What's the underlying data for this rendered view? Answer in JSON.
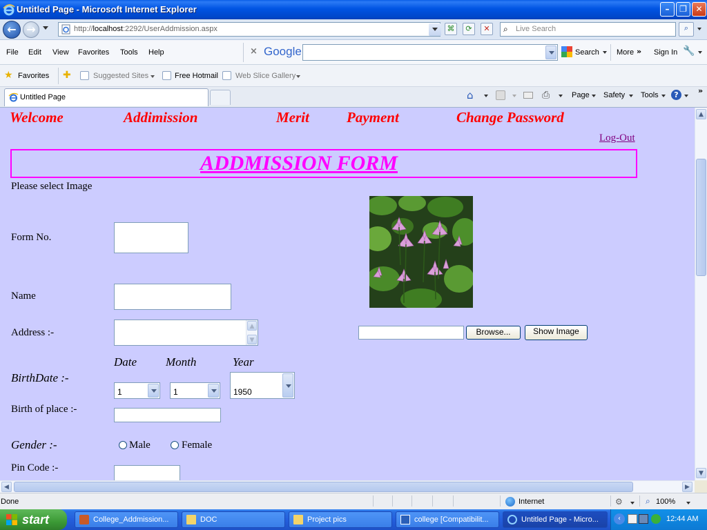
{
  "window": {
    "title": "Untitled Page - Microsoft Internet Explorer"
  },
  "addressbar": {
    "url_prefix": "http://",
    "url_host": "localhost",
    "url_rest": ":2292/UserAddmission.aspx",
    "live_search_placeholder": "Live Search"
  },
  "menubar": {
    "items": [
      "File",
      "Edit",
      "View",
      "Favorites",
      "Tools",
      "Help"
    ],
    "google_logo": "Google",
    "search_label": "Search",
    "more_label": "More",
    "signin_label": "Sign In"
  },
  "favoritesbar": {
    "favorites_label": "Favorites",
    "items": [
      "Suggested Sites",
      "Free Hotmail",
      "Web Slice Gallery"
    ]
  },
  "tabbar": {
    "tab_title": "Untitled Page",
    "page_label": "Page",
    "safety_label": "Safety",
    "tools_label": "Tools"
  },
  "page": {
    "nav": [
      "Welcome",
      "Addimission",
      "Merit",
      "Payment",
      "Change Password"
    ],
    "logout": "Log-Out",
    "form_title": "ADDMISSION FORM",
    "select_image_label": "Please select Image",
    "labels": {
      "form_no": "Form No.",
      "name": "Name",
      "address": "Address :-",
      "birthdate": "BirthDate :-",
      "date": "Date",
      "month": "Month",
      "year": "Year",
      "birth_place": "Birth of place :-",
      "gender": "Gender :-",
      "male": "Male",
      "female": "Female",
      "pin_code": "Pin Code :-"
    },
    "selects": {
      "date": "1",
      "month": "1",
      "year": "1950"
    },
    "browse_label": "Browse...",
    "show_image_label": "Show Image"
  },
  "statusbar": {
    "status": "Done",
    "zone": "Internet",
    "zoom": "100%"
  },
  "taskbar": {
    "start_label": "start",
    "tasks": [
      "College_Addmission...",
      "DOC",
      "Project pics",
      "college [Compatibilit...",
      "Untitled Page - Micro..."
    ],
    "clock": "12:44 AM"
  },
  "colors": {
    "page_background": "#ccccff",
    "nav_link": "#ff0000",
    "form_title": "#ff00ff",
    "logout_link": "#800080"
  }
}
